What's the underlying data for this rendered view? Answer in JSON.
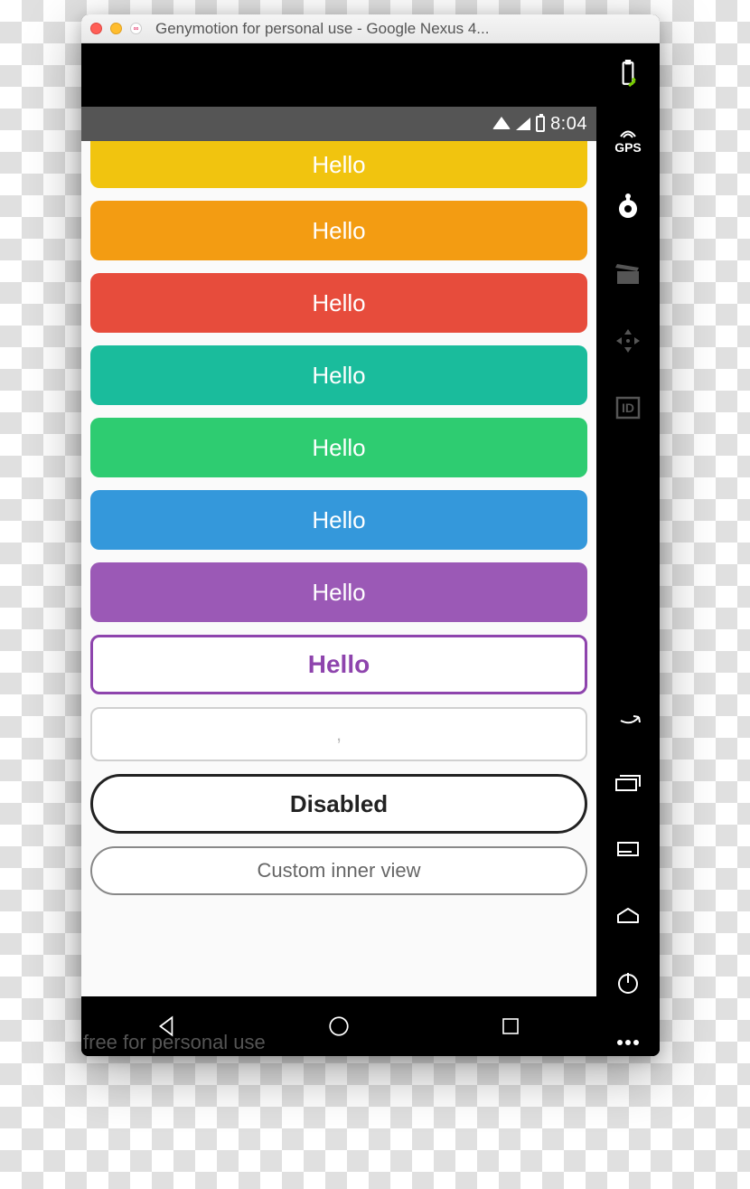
{
  "window": {
    "title": "Genymotion for personal use - Google Nexus 4..."
  },
  "statusbar": {
    "time": "8:04"
  },
  "buttons": [
    {
      "label": "Hello",
      "color": "#f1c40f"
    },
    {
      "label": "Hello",
      "color": "#f39c12"
    },
    {
      "label": "Hello",
      "color": "#e74c3c"
    },
    {
      "label": "Hello",
      "color": "#1abc9c"
    },
    {
      "label": "Hello",
      "color": "#2ecc71"
    },
    {
      "label": "Hello",
      "color": "#3498db"
    },
    {
      "label": "Hello",
      "color": "#9b59b6"
    }
  ],
  "outline_button": {
    "label": "Hello"
  },
  "faint_button": {
    "label": ","
  },
  "disabled_button": {
    "label": "Disabled"
  },
  "custom_button": {
    "label": "Custom inner view"
  },
  "watermark": "free for personal use",
  "sidebar": {
    "gps": "GPS",
    "id": "ID"
  }
}
